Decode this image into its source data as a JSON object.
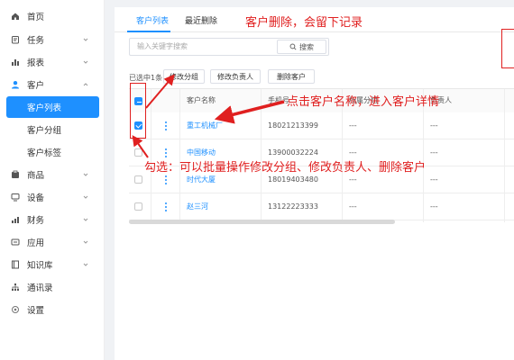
{
  "sidebar": {
    "items": [
      {
        "label": "首页",
        "icon": "home-icon"
      },
      {
        "label": "任务",
        "icon": "task-icon"
      },
      {
        "label": "报表",
        "icon": "report-icon"
      },
      {
        "label": "客户",
        "icon": "user-icon"
      },
      {
        "label": "客户列表"
      },
      {
        "label": "客户分组"
      },
      {
        "label": "客户标签"
      },
      {
        "label": "商品",
        "icon": "goods-icon"
      },
      {
        "label": "设备",
        "icon": "device-icon"
      },
      {
        "label": "财务",
        "icon": "finance-icon"
      },
      {
        "label": "应用",
        "icon": "app-icon"
      },
      {
        "label": "知识库",
        "icon": "knowledge-icon"
      },
      {
        "label": "通讯录",
        "icon": "contacts-icon"
      },
      {
        "label": "设置",
        "icon": "settings-icon"
      }
    ],
    "active_color": "#1e90ff"
  },
  "tabs": [
    {
      "label": "客户列表",
      "active": true
    },
    {
      "label": "最近删除",
      "active": false
    }
  ],
  "search": {
    "placeholder": "输入关键字搜索",
    "button_label": "搜索"
  },
  "toolbar": {
    "selected_text": "已选中1条",
    "buttons": [
      "修改分组",
      "修改负责人",
      "删除客户"
    ]
  },
  "table": {
    "columns": [
      "客户名称",
      "手机号",
      "所属分组",
      "负责人"
    ],
    "rows": [
      {
        "name": "重工机械厂",
        "phone": "18021213399",
        "group": "---",
        "owner": "---",
        "checked": true
      },
      {
        "name": "中国移动",
        "phone": "13900032224",
        "group": "---",
        "owner": "---",
        "checked": false
      },
      {
        "name": "时代大厦",
        "phone": "18019403480",
        "group": "---",
        "owner": "---",
        "checked": false
      },
      {
        "name": "赵三河",
        "phone": "13122223333",
        "group": "---",
        "owner": "---",
        "checked": false
      }
    ]
  },
  "annotations": {
    "delete_note": "客户删除，会留下记录",
    "click_note": "点击客户名称，进入客户详情",
    "check_note": "勾选：可以批量操作修改分组、修改负责人、删除客户"
  },
  "colors": {
    "accent": "#1e90ff",
    "annotation": "#e02020"
  }
}
